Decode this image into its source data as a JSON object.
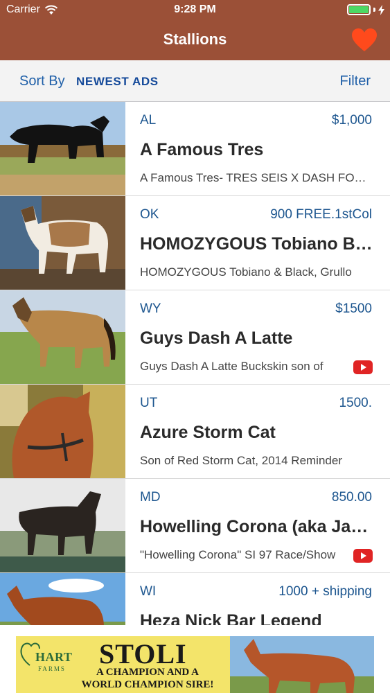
{
  "status_bar": {
    "carrier": "Carrier",
    "time": "9:28 PM"
  },
  "nav": {
    "title": "Stallions",
    "favorite_icon": "heart-icon",
    "favorite_color": "#ff4a1c"
  },
  "sort_bar": {
    "sort_label": "Sort By",
    "sort_value": "NEWEST ADS",
    "filter_label": "Filter"
  },
  "listings": [
    {
      "state": "AL",
      "price": "$1,000",
      "title": "A Famous Tres",
      "description": "A Famous Tres- TRES SEIS X DASH FOR PERKS",
      "has_video": false
    },
    {
      "state": "OK",
      "price": "900 FREE.1stCol",
      "title": "HOMOZYGOUS Tobiano Black",
      "description": "HOMOZYGOUS Tobiano & Black, Grullo",
      "has_video": false
    },
    {
      "state": "WY",
      "price": "$1500",
      "title": "Guys Dash A Latte",
      "description": "Guys Dash A Latte Buckskin son of",
      "has_video": true
    },
    {
      "state": "UT",
      "price": "1500.",
      "title": "Azure Storm Cat",
      "description": "Son of Red Storm Cat, 2014 Reminder",
      "has_video": false
    },
    {
      "state": "MD",
      "price": "850.00",
      "title": "Howelling Corona (aka Jackson)",
      "description": "\"Howelling Corona\" SI 97 Race/Show",
      "has_video": true
    },
    {
      "state": "WI",
      "price": "1000 + shipping",
      "title": "Heza Nick Bar Legend",
      "description": "",
      "has_video": false
    }
  ],
  "ad": {
    "logo_text": "HART",
    "logo_subtext": "FARMS",
    "headline": "STOLI",
    "line1": "A CHAMPION AND A",
    "line2": "WORLD CHAMPION SIRE!"
  }
}
